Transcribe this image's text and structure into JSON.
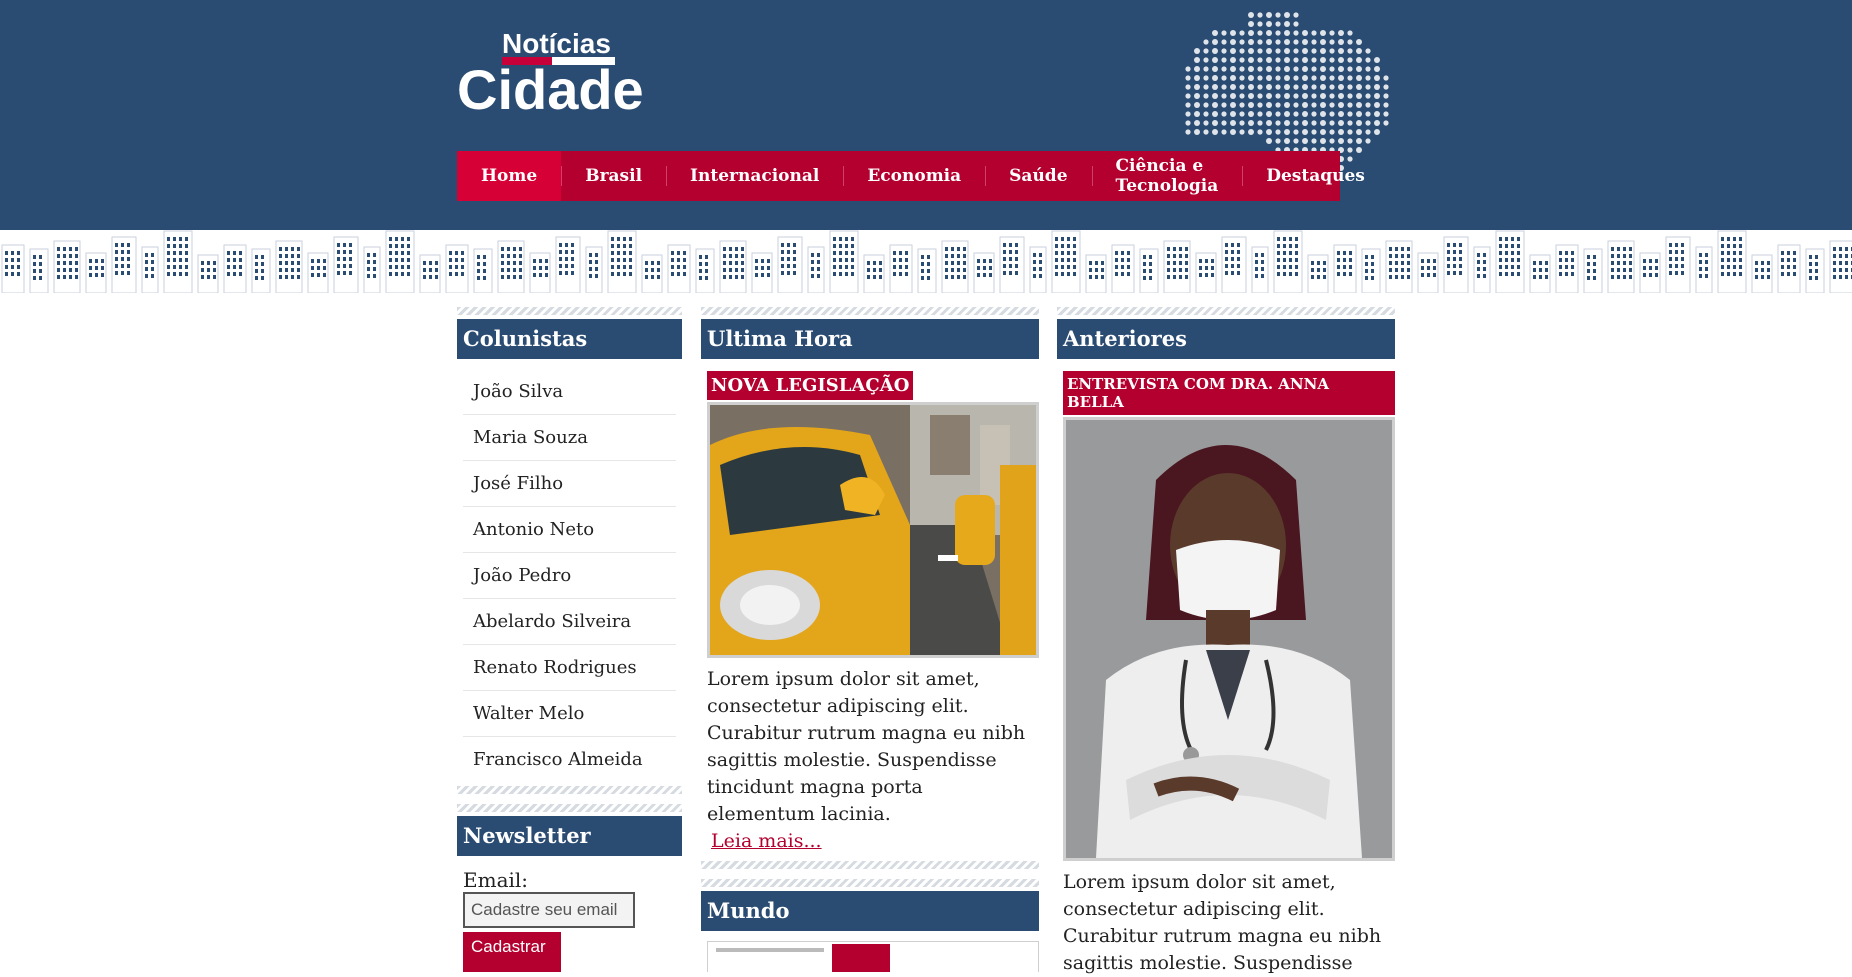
{
  "brand": {
    "small_word": "Notícias",
    "big_word": "Cidade"
  },
  "colors": {
    "header_bg": "#2b4c72",
    "accent": "#b3002f",
    "active_nav": "#d60036"
  },
  "nav": {
    "items": [
      {
        "label": "Home",
        "active": true
      },
      {
        "label": "Brasil",
        "active": false
      },
      {
        "label": "Internacional",
        "active": false
      },
      {
        "label": "Economia",
        "active": false
      },
      {
        "label": "Saúde",
        "active": false
      },
      {
        "label": "Ciência e Tecnologia",
        "active": false
      },
      {
        "label": "Destaques",
        "active": false
      }
    ]
  },
  "columnists": {
    "title": "Colunistas",
    "items": [
      "João Silva",
      "Maria Souza",
      "José Filho",
      "Antonio Neto",
      "João Pedro",
      "Abelardo Silveira",
      "Renato Rodrigues",
      "Walter Melo",
      "Francisco Almeida"
    ]
  },
  "newsletter": {
    "title": "Newsletter",
    "email_label": "Email:",
    "email_placeholder": "Cadastre seu email",
    "submit_label": "Cadastrar"
  },
  "ultima_hora": {
    "title": "Ultima Hora",
    "tag": "NOVA LEGISLAÇÃO",
    "image": "taxi-street-photo",
    "text": "Lorem ipsum dolor sit amet, consectetur adipiscing elit. Curabitur rutrum magna eu nibh sagittis molestie. Suspendisse tincidunt magna porta elementum lacinia.",
    "read_more": "Leia mais..."
  },
  "mundo": {
    "title": "Mundo"
  },
  "anteriores": {
    "title": "Anteriores",
    "tag": "ENTREVISTA COM DRA. ANNA BELLA",
    "image": "doctor-portrait-photo",
    "text": "Lorem ipsum dolor sit amet, consectetur adipiscing elit. Curabitur rutrum magna eu nibh sagittis molestie. Suspendisse"
  }
}
